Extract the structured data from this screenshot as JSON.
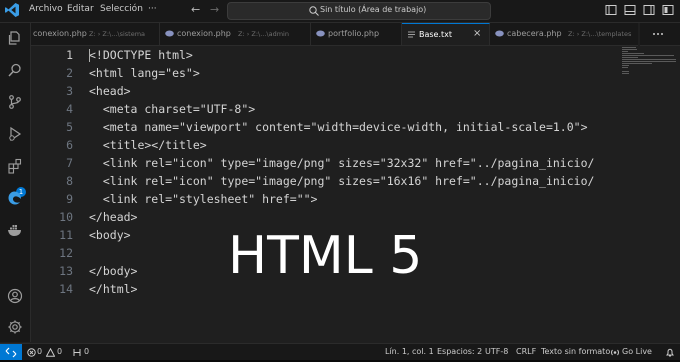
{
  "menu": [
    "Archivo",
    "Editar",
    "Selección",
    "···"
  ],
  "command_center": {
    "text": "Sin título (Área de trabajo)"
  },
  "tabs": [
    {
      "name": "conexion.php",
      "path": "Z: › Z:\\...\\sistema"
    },
    {
      "name": "conexion.php",
      "path": "Z: › Z:\\...\\admin"
    },
    {
      "name": "portfolio.php",
      "path": ""
    },
    {
      "name": "Base.txt",
      "path": "",
      "close": "×"
    },
    {
      "name": "cabecera.php",
      "path": "Z: › Z:\\...\\templates"
    }
  ],
  "activity": {
    "extensions_badge": "1"
  },
  "editor": {
    "lines": [
      {
        "n": "1",
        "text": "<!DOCTYPE html>"
      },
      {
        "n": "2",
        "text": "<html lang=\"es\">"
      },
      {
        "n": "3",
        "text": "<head>"
      },
      {
        "n": "4",
        "text": "  <meta charset=\"UTF-8\">"
      },
      {
        "n": "5",
        "text": "  <meta name=\"viewport\" content=\"width=device-width, initial-scale=1.0\">"
      },
      {
        "n": "6",
        "text": "  <title></title>"
      },
      {
        "n": "7",
        "text": "  <link rel=\"icon\" type=\"image/png\" sizes=\"32x32\" href=\"../pagina_inicio/"
      },
      {
        "n": "8",
        "text": "  <link rel=\"icon\" type=\"image/png\" sizes=\"16x16\" href=\"../pagina_inicio/"
      },
      {
        "n": "9",
        "text": "  <link rel=\"stylesheet\" href=\"\">"
      },
      {
        "n": "10",
        "text": "</head>"
      },
      {
        "n": "11",
        "text": "<body>"
      },
      {
        "n": "12",
        "text": ""
      },
      {
        "n": "13",
        "text": "</body>"
      },
      {
        "n": "14",
        "text": "</html>"
      }
    ],
    "current_line": 1
  },
  "overlay_text": "HTML 5",
  "status": {
    "errors": "0",
    "warnings": "0",
    "ports": "0",
    "position": "Lín. 1, col. 1",
    "spaces": "Espacios: 2",
    "encoding": "UTF-8",
    "eol": "CRLF",
    "language": "Texto sin formato",
    "golive": "Go Live"
  },
  "colors": {
    "accent": "#0078d4",
    "background": "#1f1f1f",
    "chrome": "#181818"
  }
}
